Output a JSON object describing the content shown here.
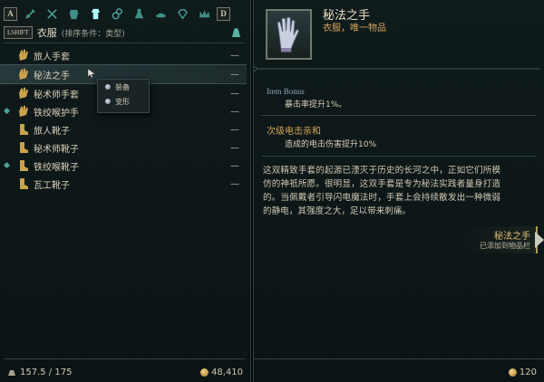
{
  "left_panel": {
    "key_left": "A",
    "key_right": "D",
    "categories": [
      "weapons",
      "armor",
      "gloves",
      "rings",
      "potions",
      "lamp",
      "gems",
      "crown"
    ],
    "shift_key": "LSHIFT",
    "category_title": "衣服",
    "sort_label": "(排序条件：类型)",
    "items": [
      {
        "name": "旅人手套",
        "qty": "—",
        "type": "glove",
        "marked": false,
        "selected": false
      },
      {
        "name": "秘法之手",
        "qty": "—",
        "type": "glove",
        "marked": false,
        "selected": true
      },
      {
        "name": "秘术师手套",
        "qty": "—",
        "type": "glove",
        "marked": false,
        "selected": false
      },
      {
        "name": "铁绞喉护手",
        "qty": "—",
        "type": "glove",
        "marked": true,
        "selected": false
      },
      {
        "name": "旅人靴子",
        "qty": "—",
        "type": "boot",
        "marked": false,
        "selected": false
      },
      {
        "name": "秘术师靴子",
        "qty": "—",
        "type": "boot",
        "marked": false,
        "selected": false
      },
      {
        "name": "铁绞喉靴子",
        "qty": "—",
        "type": "boot",
        "marked": true,
        "selected": false
      },
      {
        "name": "瓦工靴子",
        "qty": "—",
        "type": "boot",
        "marked": false,
        "selected": false
      }
    ],
    "context_menu": {
      "equip": "装备",
      "transform": "变形"
    },
    "weight": "157.5 / 175",
    "gold": "48,410"
  },
  "detail": {
    "item_name": "秘法之手",
    "item_type": "衣服，唯一物品",
    "bonus_label": "Item Bonus",
    "bonus_value": "暴击率提升1%。",
    "secondary_title": "次级电击亲和",
    "secondary_value": "造成的电击伤害提升10%",
    "description": "这双精致手套的起源已湮灭于历史的长河之中，正如它们所模仿的神祇所愿。很明显，这双手套是专为秘法实践者量身打造的。当佩戴者引导闪电魔法时，手套上会持续散发出一种微弱的静电，其强度之大，足以带来刺痛。",
    "price": "120"
  },
  "toast": {
    "title": "秘法之手",
    "subtitle": "已添加到物品栏"
  },
  "colors": {
    "accent_gold": "#d0a658",
    "text": "#cfc8b2",
    "panel_bg": "#0f1a1b"
  }
}
